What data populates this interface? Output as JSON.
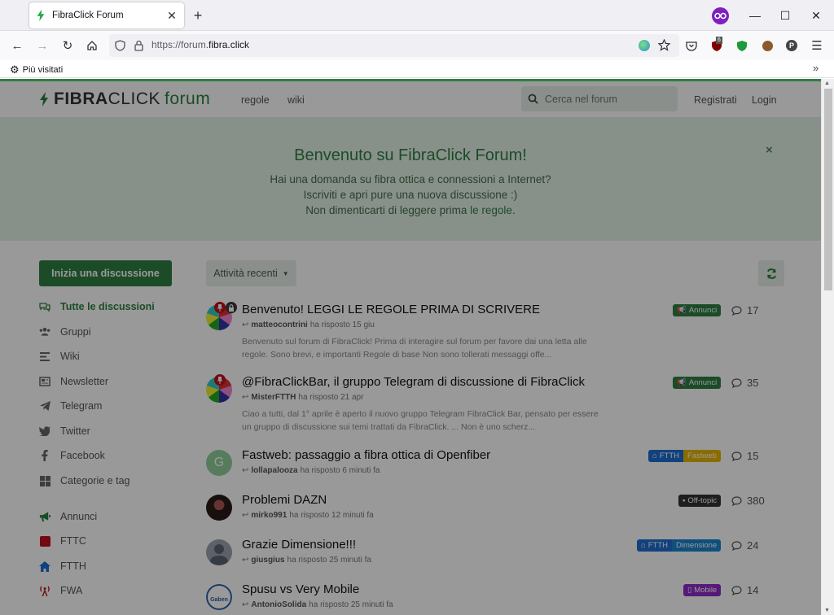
{
  "browser": {
    "tab_title": "FibraClick Forum",
    "url_prefix": "https://forum.",
    "url_domain": "fibra.click",
    "bookmark_label": "Più visitati",
    "ublock_count": "6"
  },
  "header": {
    "logo_fibra": "FIBRA",
    "logo_click": "CLICK",
    "logo_forum": "forum",
    "links": [
      "regole",
      "wiki"
    ],
    "search_placeholder": "Cerca nel forum",
    "register": "Registrati",
    "login": "Login"
  },
  "hero": {
    "title": "Benvenuto su FibraClick Forum!",
    "line1": "Hai una domanda su fibra ottica e connessioni a Internet?",
    "line2": "Iscriviti e apri pure una nuova discussione :)",
    "line3_prefix": "Non dimenticarti di leggere prima ",
    "line3_link": "le regole",
    "line3_suffix": ".",
    "close": "×"
  },
  "sidebar": {
    "start_button": "Inizia una discussione",
    "items": [
      {
        "label": "Tutte le discussioni",
        "icon": "comments-icon"
      },
      {
        "label": "Gruppi",
        "icon": "users-icon"
      },
      {
        "label": "Wiki",
        "icon": "align-left-icon"
      },
      {
        "label": "Newsletter",
        "icon": "newspaper-icon"
      },
      {
        "label": "Telegram",
        "icon": "telegram-icon"
      },
      {
        "label": "Twitter",
        "icon": "twitter-icon"
      },
      {
        "label": "Facebook",
        "icon": "facebook-icon"
      },
      {
        "label": "Categorie e tag",
        "icon": "grid-icon"
      },
      {
        "label": "Annunci",
        "icon": "bullhorn-icon"
      },
      {
        "label": "FTTC",
        "icon": "square-icon"
      },
      {
        "label": "FTTH",
        "icon": "home-icon"
      },
      {
        "label": "FWA",
        "icon": "antenna-icon"
      }
    ]
  },
  "toolbar": {
    "sort_label": "Attività recenti"
  },
  "discussions": [
    {
      "title": "Benvenuto! LEGGI LE REGOLE PRIMA DI SCRIVERE",
      "user": "matteocontrini",
      "action": "ha risposto 15 giu",
      "excerpt": "Benvenuto sul forum di FibraClick! Prima di interagire sul forum per favore dai una letta alle regole. Sono brevi, e importanti Regole di base Non sono tollerati messaggi offe...",
      "tags": [
        {
          "label": "Annunci",
          "color": "#2d7f42"
        }
      ],
      "replies": "17"
    },
    {
      "title": "@FibraClickBar, il gruppo Telegram di discussione di FibraClick",
      "user": "MisterFTTH",
      "action": "ha risposto 21 apr",
      "excerpt": "Ciao a tutti, dal 1° aprile è aperto il nuovo gruppo Telegram FibraClick Bar, pensato per essere un gruppo di discussione sui temi trattati da FibraClick. ... Non è uno scherz...",
      "tags": [
        {
          "label": "Annunci",
          "color": "#2d7f42"
        }
      ],
      "replies": "35"
    },
    {
      "title": "Fastweb: passaggio a fibra ottica di Openfiber",
      "user": "lollapalooza",
      "action": "ha risposto 6 minuti fa",
      "excerpt": "",
      "tags": [
        {
          "label": "FTTH",
          "color": "#1f6fd1"
        },
        {
          "label": "Fastweb",
          "color": "#e7b400"
        }
      ],
      "replies": "15"
    },
    {
      "title": "Problemi DAZN",
      "user": "mirko991",
      "action": "ha risposto 12 minuti fa",
      "excerpt": "",
      "tags": [
        {
          "label": "Off-topic",
          "color": "#333333"
        }
      ],
      "replies": "380"
    },
    {
      "title": "Grazie Dimensione!!!",
      "user": "giusgius",
      "action": "ha risposto 25 minuti fa",
      "excerpt": "",
      "tags": [
        {
          "label": "FTTH",
          "color": "#1f6fd1"
        },
        {
          "label": "Dimensione",
          "color": "#1b84cf"
        }
      ],
      "replies": "24"
    },
    {
      "title": "Spusu vs Very Mobile",
      "user": "AntonioSolida",
      "action": "ha risposto 25 minuti fa",
      "excerpt": "",
      "tags": [
        {
          "label": "Mobile",
          "color": "#8e2bc9"
        }
      ],
      "replies": "14"
    }
  ],
  "avatar_letters": {
    "lollapalooza": "G",
    "antoniosolida": "Gaben"
  },
  "colors": {
    "brand": "#2d7f42",
    "hero_bg": "#e3f1e6",
    "button_bg": "#e6eee8"
  }
}
